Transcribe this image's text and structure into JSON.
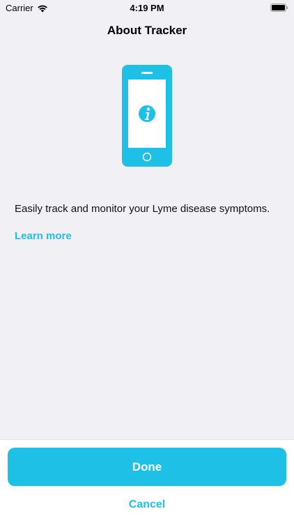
{
  "status_bar": {
    "carrier": "Carrier",
    "time": "4:19 PM"
  },
  "nav": {
    "title": "About Tracker"
  },
  "content": {
    "icon": "phone-info-icon",
    "description": "Easily track and monitor your Lyme disease symptoms.",
    "learn_more": "Learn more"
  },
  "actions": {
    "done": "Done",
    "cancel": "Cancel"
  },
  "colors": {
    "accent": "#1ec0e6",
    "background": "#f1f0f5",
    "panel": "#ffffff"
  }
}
